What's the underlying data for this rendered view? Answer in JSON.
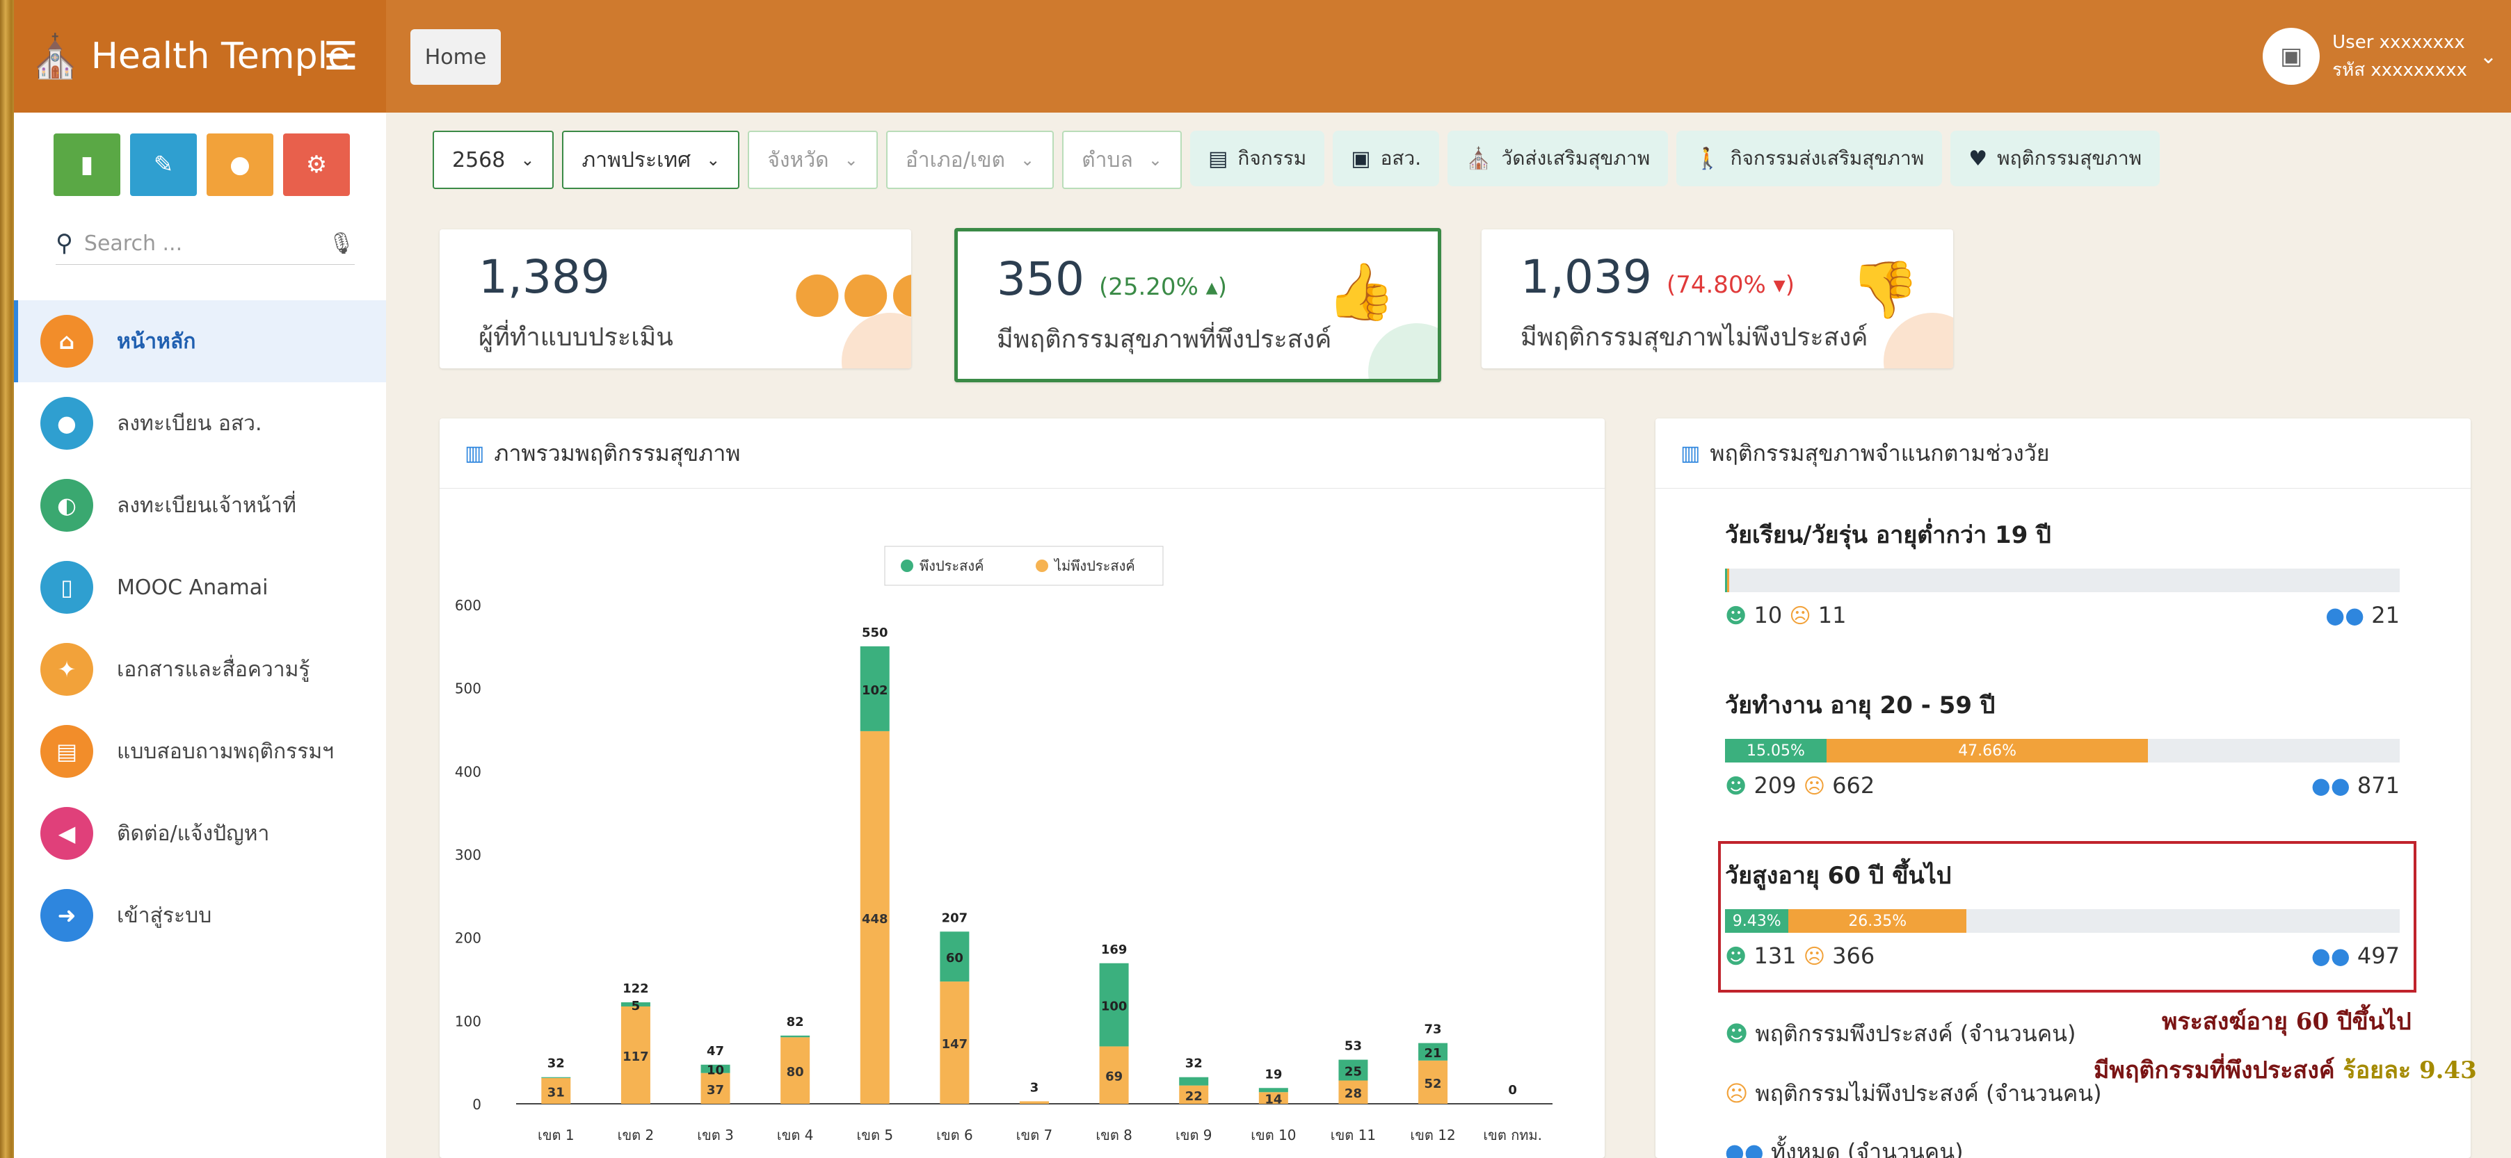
{
  "brand": {
    "name": "Health Temple",
    "logo_icon": "temple-icon",
    "menu_icon": "hamburger-icon"
  },
  "header": {
    "breadcrumb": "Home",
    "user_name": "User xxxxxxxx",
    "user_code": "รหัส xxxxxxxxx"
  },
  "sidebar": {
    "quick_buttons": [
      {
        "icon": "chart-icon",
        "color": "#5aa845"
      },
      {
        "icon": "edit-icon",
        "color": "#2f9fd0"
      },
      {
        "icon": "users-icon",
        "color": "#f2a23a"
      },
      {
        "icon": "settings-icon",
        "color": "#e8604c"
      }
    ],
    "search_placeholder": "Search ...",
    "items": [
      {
        "label": "หน้าหลัก",
        "icon": "home-icon",
        "color": "#f28d2a",
        "active": true
      },
      {
        "label": "ลงทะเบียน อสว.",
        "icon": "users-icon",
        "color": "#2f9fd0"
      },
      {
        "label": "ลงทะเบียนเจ้าหน้าที่",
        "icon": "user-cog-icon",
        "color": "#3aa870"
      },
      {
        "label": "MOOC Anamai",
        "icon": "book-icon",
        "color": "#2f9fd0"
      },
      {
        "label": "เอกสารและสื่อความรู้",
        "icon": "lightbulb-icon",
        "color": "#f2a23a"
      },
      {
        "label": "แบบสอบถามพฤติกรรมฯ",
        "icon": "document-icon",
        "color": "#f28d2a"
      },
      {
        "label": "ติดต่อ/แจ้งปัญหา",
        "icon": "megaphone-icon",
        "color": "#e0407a"
      },
      {
        "label": "เข้าสู่ระบบ",
        "icon": "login-icon",
        "color": "#2e86de"
      }
    ]
  },
  "filters": {
    "year": "2568",
    "region": "ภาพประเทศ",
    "province": "จังหวัด",
    "district": "อำเภอ/เขต",
    "subdistrict": "ตำบล",
    "tabs": [
      {
        "label": "กิจกรรม",
        "icon": "table-icon"
      },
      {
        "label": "อสว.",
        "icon": "id-card-icon"
      },
      {
        "label": "วัดส่งเสริมสุขภาพ",
        "icon": "temple-icon"
      },
      {
        "label": "กิจกรรมส่งเสริมสุขภาพ",
        "icon": "walking-icon"
      },
      {
        "label": "พฤติกรรมสุขภาพ",
        "icon": "heartbeat-icon"
      }
    ]
  },
  "stats": [
    {
      "value": "1,389",
      "pct": "",
      "label": "ผู้ที่ทำแบบประเมิน",
      "icon": "users-icon",
      "color": "#f2a23a"
    },
    {
      "value": "350",
      "pct": "(25.20% ▴)",
      "label": "มีพฤติกรรมสุขภาพที่พึงประสงค์",
      "icon": "thumbs-up-icon",
      "color": "#3a8a46"
    },
    {
      "value": "1,039",
      "pct": "(74.80% ▾)",
      "label": "มีพฤติกรรมสุขภาพไม่พึงประสงค์",
      "icon": "thumbs-down-icon",
      "color": "#e03a3a"
    }
  ],
  "overview_panel": {
    "title": "ภาพรวมพฤติกรรมสุขภาพ"
  },
  "chart_data": {
    "type": "bar",
    "stacked": true,
    "title": "",
    "xlabel": "",
    "ylabel": "",
    "ylim": [
      0,
      600
    ],
    "yticks": [
      0,
      100,
      200,
      300,
      400,
      500,
      600
    ],
    "categories": [
      "เขต 1",
      "เขต 2",
      "เขต 3",
      "เขต 4",
      "เขต 5",
      "เขต 6",
      "เขต 7",
      "เขต 8",
      "เขต 9",
      "เขต 10",
      "เขต 11",
      "เขต 12",
      "เขต กทม."
    ],
    "totals": [
      "32",
      "122",
      "47",
      "82",
      "550",
      "207",
      "3",
      "169",
      "32",
      "19",
      "53",
      "73",
      "0"
    ],
    "legend_position": "top",
    "series": [
      {
        "name": "ไม่พึงประสงค์",
        "color": "#f6b352",
        "values": [
          31,
          117,
          37,
          80,
          448,
          147,
          3,
          69,
          22,
          14,
          28,
          52,
          0
        ],
        "labels": [
          "31",
          "117",
          "37",
          "80",
          "448",
          "147",
          "",
          "69",
          "22",
          "14",
          "28",
          "52",
          ""
        ]
      },
      {
        "name": "พึงประสงค์",
        "color": "#3bb07e",
        "values": [
          1,
          5,
          10,
          2,
          102,
          60,
          0,
          100,
          10,
          5,
          25,
          21,
          0
        ],
        "labels": [
          "",
          "5",
          "10",
          "",
          "102",
          "60",
          "",
          "100",
          "",
          "",
          "25",
          "21",
          ""
        ]
      }
    ],
    "legend": [
      "พึงประสงค์",
      "ไม่พึงประสงค์"
    ]
  },
  "age_panel": {
    "title": "พฤติกรรมสุขภาพจำแนกตามช่วงวัย",
    "groups": [
      {
        "title": "วัยเรียน/วัยรุ่น อายุต่ำกว่า 19 ปี",
        "good": "10",
        "bad": "11",
        "total": "21",
        "good_pct": 0.3,
        "bad_pct": 0.3,
        "good_label": "",
        "bad_label": ""
      },
      {
        "title": "วัยทำงาน อายุ 20 - 59 ปี",
        "good": "209",
        "bad": "662",
        "total": "871",
        "good_pct": 15.05,
        "bad_pct": 47.66,
        "good_label": "15.05%",
        "bad_label": "47.66%"
      },
      {
        "title": "วัยสูงอายุ 60 ปี ขึ้นไป",
        "good": "131",
        "bad": "366",
        "total": "497",
        "good_pct": 9.43,
        "bad_pct": 26.35,
        "good_label": "9.43%",
        "bad_label": "26.35%"
      }
    ],
    "legend": [
      {
        "icon": "smile-icon",
        "label": "พฤติกรรมพึงประสงค์ (จำนวนคน)",
        "color": "#3bb07e"
      },
      {
        "icon": "frown-icon",
        "label": "พฤติกรรมไม่พึงประสงค์ (จำนวนคน)",
        "color": "#f2a23a"
      },
      {
        "icon": "users-icon",
        "label": "ทั้งหมด (จำนวนคน)",
        "color": "#2e86de"
      }
    ]
  },
  "annotation": {
    "line1": "พระสงฆ์อายุ 60 ปีขึ้นไป",
    "line2": "มีพฤติกรรมที่พึงประสงค์",
    "line2_highlight": "ร้อยละ 9.43"
  }
}
